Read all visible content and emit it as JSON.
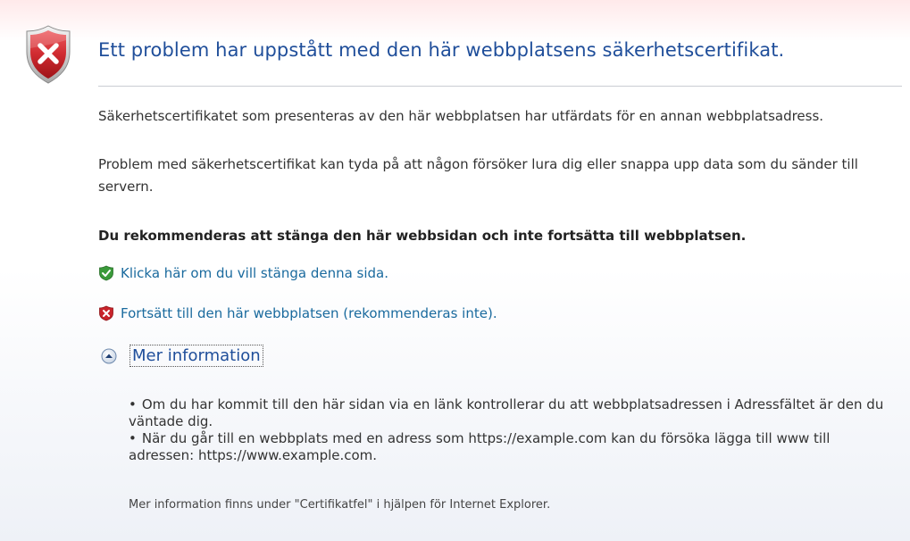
{
  "header": {
    "title": "Ett problem har uppstått med den här webbplatsens säkerhetscertifikat."
  },
  "body": {
    "paragraph1": "Säkerhetscertifikatet som presenteras av den här webbplatsen har utfärdats för en annan webbplatsadress.",
    "paragraph2": "Problem med säkerhetscertifikat kan tyda på att någon försöker lura dig eller snappa upp data som du sänder till servern.",
    "recommendation": "Du rekommenderas att stänga den här webbsidan och inte fortsätta till webbplatsen."
  },
  "actions": {
    "close_page": "Klicka här om du vill stänga denna sida.",
    "continue": "Fortsätt till den här webbplatsen (rekommenderas inte)."
  },
  "more_info": {
    "toggle_label": "Mer information",
    "bullets": [
      "Om du har kommit till den här sidan via en länk kontrollerar du att webbplatsadressen i Adressfältet är den du väntade dig.",
      "När du går till en webbplats med en adress som https://example.com kan du försöka lägga till www till adressen: https://www.example.com."
    ],
    "footer": "Mer information finns under \"Certifikatfel\" i hjälpen för Internet Explorer."
  },
  "icons": {
    "header_icon": "shield-error-icon",
    "close_page_icon": "shield-ok-icon",
    "continue_icon": "shield-error-icon",
    "toggle_icon": "chevron-up-circle-icon"
  },
  "colors": {
    "title": "#1f4e9a",
    "link": "#1a6a9e",
    "error_red": "#c8242b",
    "ok_green": "#3a9a3a"
  }
}
